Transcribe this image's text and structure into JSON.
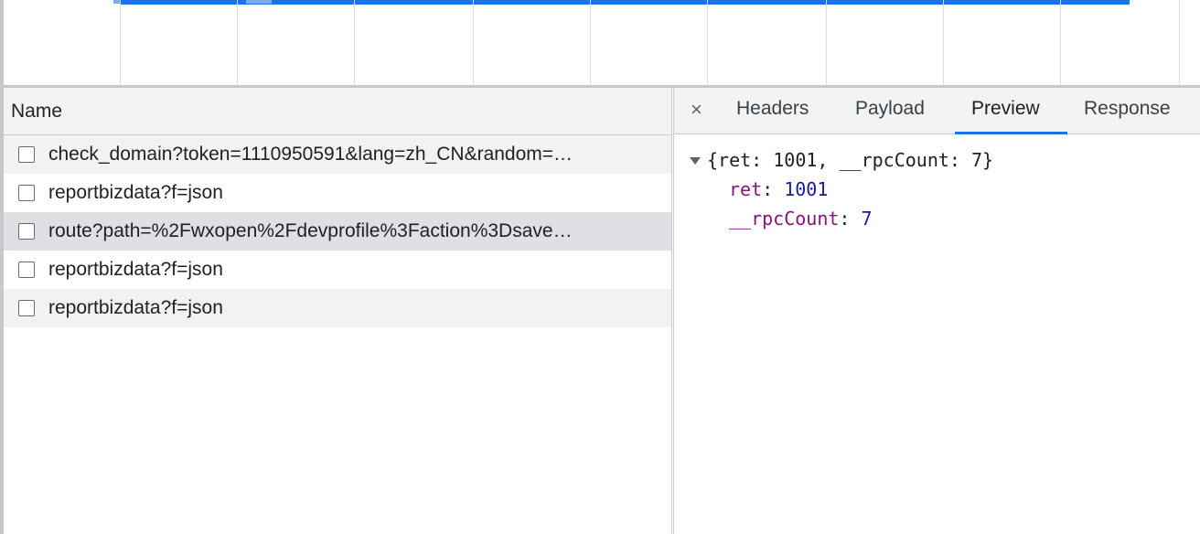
{
  "request_list": {
    "header": "Name",
    "rows": [
      {
        "name": "check_domain?token=1110950591&lang=zh_CN&random=…"
      },
      {
        "name": "reportbizdata?f=json"
      },
      {
        "name": "route?path=%2Fwxopen%2Fdevprofile%3Faction%3Dsave…"
      },
      {
        "name": "reportbizdata?f=json"
      },
      {
        "name": "reportbizdata?f=json"
      }
    ]
  },
  "details": {
    "close_glyph": "×",
    "tabs": [
      {
        "label": "Headers"
      },
      {
        "label": "Payload"
      },
      {
        "label": "Preview"
      },
      {
        "label": "Response"
      }
    ],
    "active_tab": "Preview"
  },
  "preview": {
    "summary": "{ret: 1001, __rpcCount: 7}",
    "fields": [
      {
        "key": "ret",
        "separator": ": ",
        "value": "1001"
      },
      {
        "key": "__rpcCount",
        "separator": ": ",
        "value": "7"
      }
    ]
  },
  "colors": {
    "accent": "#1a73e8",
    "json_key": "#881280",
    "json_number": "#1a1aa6",
    "selected_row": "#dfe0e3"
  }
}
